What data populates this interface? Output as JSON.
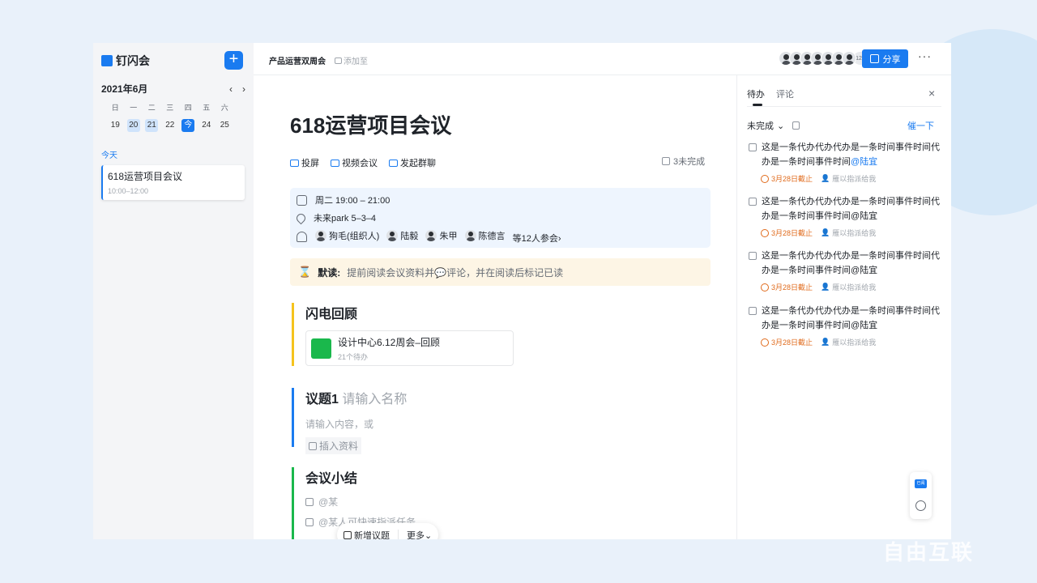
{
  "sidebar": {
    "brand": "钉闪会",
    "add_label": "+",
    "calendar": {
      "month": "2021年6月",
      "prev": "‹",
      "next": "›",
      "weekdays": [
        "日",
        "一",
        "二",
        "三",
        "四",
        "五",
        "六"
      ],
      "days": [
        "19",
        "20",
        "21",
        "22",
        "今",
        "24",
        "25"
      ]
    },
    "today_label": "今天",
    "meeting": {
      "title": "618运营项目会议",
      "time": "10:00–12:00"
    }
  },
  "topbar": {
    "breadcrumb": "产品运营双周会",
    "add_to": "添加至",
    "attendee_count": "123",
    "share_label": "分享",
    "more_label": "···"
  },
  "doc": {
    "title": "618运营项目会议",
    "tools": [
      "投屏",
      "视频会议",
      "发起群聊"
    ],
    "undone": "3未完成",
    "info": {
      "time": "周二 19:00 – 21:00",
      "location": "未来park 5–3–4",
      "people": [
        "狗毛(组织人)",
        "陆毅",
        "朱甲",
        "陈德言"
      ],
      "more_people": "等12人参会"
    },
    "notice": {
      "label": "默读:",
      "text": "提前阅读会议资料并💬评论，并在阅读后标记已读"
    },
    "section1": {
      "title": "闪电回顾",
      "file_title": "设计中心6.12周会–回顾",
      "file_sub": "21个待办"
    },
    "section2": {
      "title": "议题1",
      "name_placeholder": "请输入名称",
      "content_placeholder": "请输入内容，或",
      "insert_label": "插入资料"
    },
    "section3": {
      "title": "会议小结",
      "task1": "@某",
      "task2": "@某人可快速指派任务"
    },
    "floating": {
      "new_topic": "新增议题",
      "more": "更多"
    }
  },
  "panel": {
    "tabs": [
      "待办",
      "评论"
    ],
    "close": "×",
    "filter": "未完成",
    "remind": "催一下",
    "todos": [
      {
        "text": "这是一条代办代办代办是一条时间事件时间代办是一条时间事件时间",
        "at": "@陆宜",
        "due": "3月28日截止",
        "assign": "雁以指派给我"
      },
      {
        "text": "这是一条代办代办代办是一条时间事件时间代办是一条时间事件时间@陆宜",
        "at": "",
        "due": "3月28日截止",
        "assign": "雁以指派给我"
      },
      {
        "text": "这是一条代办代办代办是一条时间事件时间代办是一条时间事件时间@陆宜",
        "at": "",
        "due": "3月28日截止",
        "assign": "雁以指派给我"
      },
      {
        "text": "这是一条代办代办代办是一条时间事件时间代办是一条时间事件时间@陆宜",
        "at": "",
        "due": "3月28日截止",
        "assign": "雁以指派给我"
      }
    ],
    "side_tool_badge": "已阅"
  },
  "watermark": "自由互联",
  "colors": {
    "accent": "#1a7bf0",
    "warning": "#e06a1b",
    "section_yellow": "#f5c31d",
    "section_blue": "#1a7bf0",
    "section_green": "#1ab84c"
  }
}
